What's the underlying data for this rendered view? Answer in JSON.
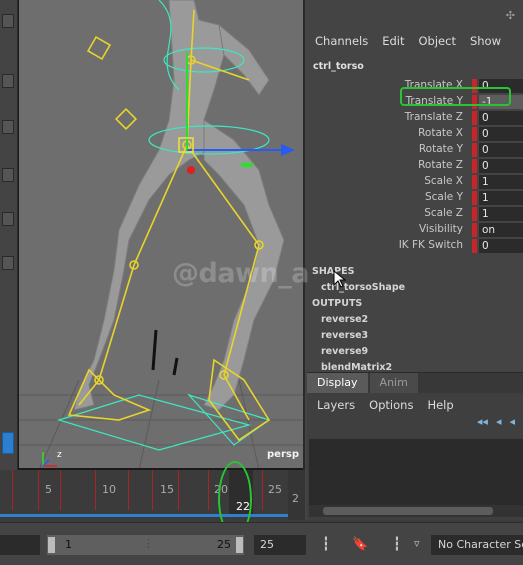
{
  "channel_box": {
    "menu": [
      "Channels",
      "Edit",
      "Object",
      "Show"
    ],
    "node_name": "ctrl_torso",
    "attributes": [
      {
        "label": "Translate X",
        "value": "0"
      },
      {
        "label": "Translate Y",
        "value": "-1"
      },
      {
        "label": "Translate Z",
        "value": "0"
      },
      {
        "label": "Rotate X",
        "value": "0"
      },
      {
        "label": "Rotate Y",
        "value": "0"
      },
      {
        "label": "Rotate Z",
        "value": "0"
      },
      {
        "label": "Scale X",
        "value": "1"
      },
      {
        "label": "Scale Y",
        "value": "1"
      },
      {
        "label": "Scale Z",
        "value": "1"
      },
      {
        "label": "Visibility",
        "value": "on"
      },
      {
        "label": "IK FK Switch",
        "value": "0"
      }
    ],
    "shapes_header": "SHAPES",
    "shape_name": "ctrl_torsoShape",
    "outputs_header": "OUTPUTS",
    "outputs": [
      "reverse2",
      "reverse3",
      "reverse9",
      "blendMatrix2"
    ]
  },
  "layer_editor": {
    "tabs": [
      "Display",
      "Anim"
    ],
    "menu": [
      "Layers",
      "Options",
      "Help"
    ],
    "arrow_glyphs": [
      "◂◂",
      "◂",
      "◂"
    ]
  },
  "viewport": {
    "camera_label": "persp",
    "axis_label": "z"
  },
  "watermark": "@dawn_a",
  "timeline": {
    "tick_labels": [
      "5",
      "10",
      "15",
      "20",
      "25"
    ],
    "current_frame": "22",
    "end_label": "2"
  },
  "range": {
    "start_field": "",
    "slider_start": "1",
    "slider_end": "25",
    "end_field": "25",
    "character_set": "No Character Set"
  },
  "colors": {
    "accent_blue": "#2d7fd0",
    "key_red": "#c6262a",
    "highlight_green": "#28c433",
    "rig_yellow": "#e8d42a",
    "rig_cyan": "#3de8c0"
  }
}
